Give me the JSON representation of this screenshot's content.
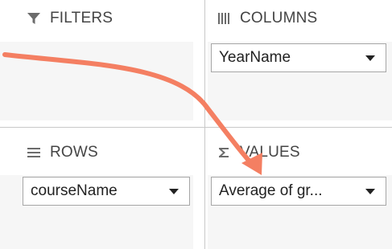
{
  "filters": {
    "label": "FILTERS",
    "icon": "filter-icon"
  },
  "columns": {
    "label": "COLUMNS",
    "icon": "columns-icon",
    "fields": [
      {
        "label": "YearName"
      }
    ]
  },
  "rows": {
    "label": "ROWS",
    "icon": "rows-icon",
    "fields": [
      {
        "label": "courseName"
      }
    ]
  },
  "values": {
    "label": "VALUES",
    "icon": "sigma-icon",
    "fields": [
      {
        "label": "Average of gr..."
      }
    ]
  },
  "annotation": {
    "icon": "annotation-arrow",
    "color": "#f47f62"
  },
  "colors": {
    "divider": "#c8c8c8",
    "area_fill": "#f6f6f6",
    "pill_border": "#a6a6a6",
    "text": "#444444"
  }
}
